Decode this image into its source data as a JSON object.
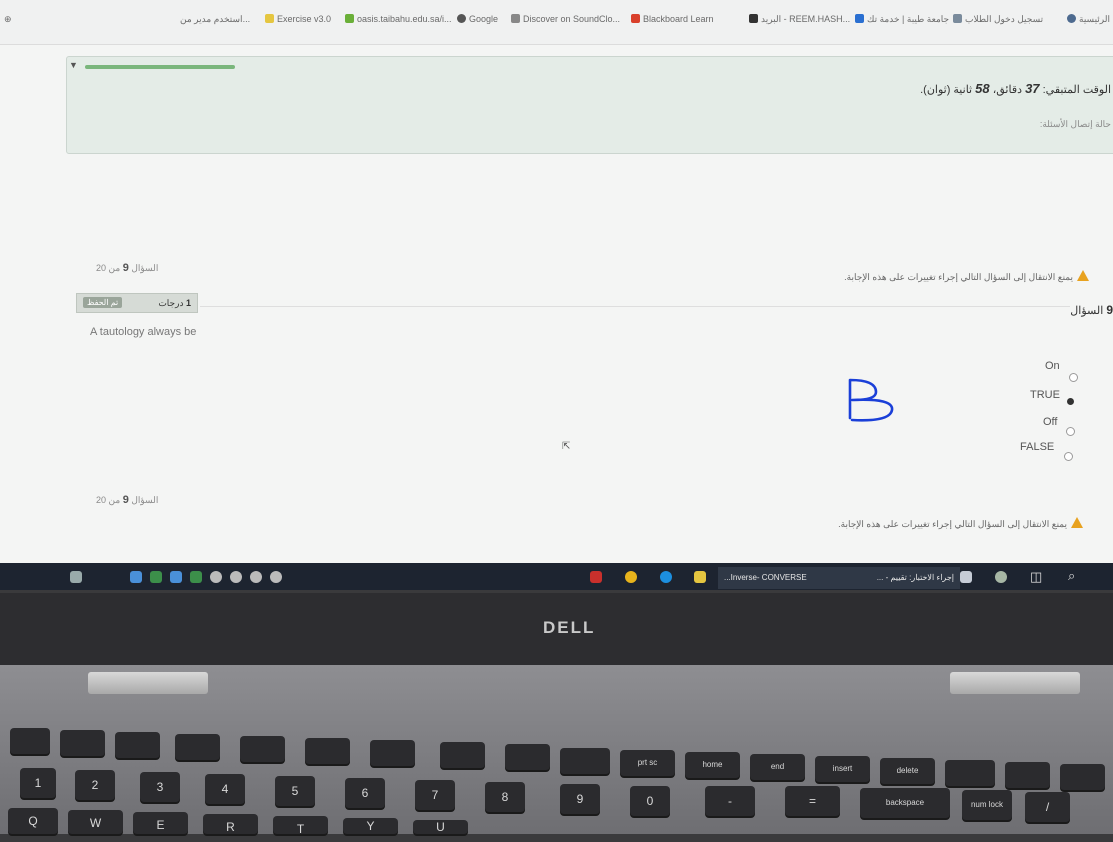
{
  "bookmarks": [
    "الرئيسية",
    "تسجيل دخول الطلاب",
    "جامعة طيبة | خدمة تك",
    "البريد - REEM.HASH...",
    "Blackboard Learn",
    "Discover on SoundClo...",
    "Google",
    "oasis.taibahu.edu.sa/i...",
    "Exercise v3.0",
    "استخدم مدير من..."
  ],
  "timer": {
    "label": "الوقت المتبقي:",
    "minutes": "37",
    "min_unit": "دقائق،",
    "seconds": "58",
    "sec_unit": "ثانية (ثوان).",
    "status": "حالة إتصال الأسئلة:"
  },
  "question": {
    "nav_top": "السؤال",
    "nav_top_num": "9",
    "nav_top_of": "من 20",
    "warning": "يمنع الانتقال إلى السؤال التالي إجراء تغييرات على هذه الإجابة.",
    "points_value": "1",
    "points_label": "درجات",
    "save_label": "تم الحفظ",
    "title": "السؤال",
    "title_num": "9",
    "text": "A tautology always be",
    "options": [
      {
        "label": "On",
        "selected": false
      },
      {
        "label": "TRUE",
        "selected": true
      },
      {
        "label": "Off",
        "selected": false
      },
      {
        "label": "FALSE",
        "selected": false
      }
    ],
    "nav_bottom": "السؤال",
    "nav_bottom_num": "9",
    "nav_bottom_of": "من 20",
    "warning_bottom": "يمنع الانتقال إلى السؤال التالي إجراء تغييرات على هذه الإجابة."
  },
  "annotation": {
    "handwritten": "B",
    "color": "#1a3fd8"
  },
  "taskbar": {
    "app1": "...Inverse- CONVERSE",
    "app2": "إجراء الاختبار: تقييم - ..."
  },
  "brand": "DELL",
  "keyboard": {
    "row2": [
      "prt sc",
      "home",
      "end",
      "insert",
      "delete"
    ],
    "row3": [
      "1",
      "2",
      "3",
      "4",
      "5",
      "6",
      "7",
      "8",
      "9",
      "0",
      "-",
      "=",
      "backspace",
      "num lock"
    ],
    "row4": [
      "Q",
      "W",
      "E",
      "R",
      "T",
      "Y",
      "U"
    ]
  },
  "colors": {
    "accent_green": "#7ab67c",
    "warning": "#e8a21f",
    "taskbar": "#1d2430"
  }
}
